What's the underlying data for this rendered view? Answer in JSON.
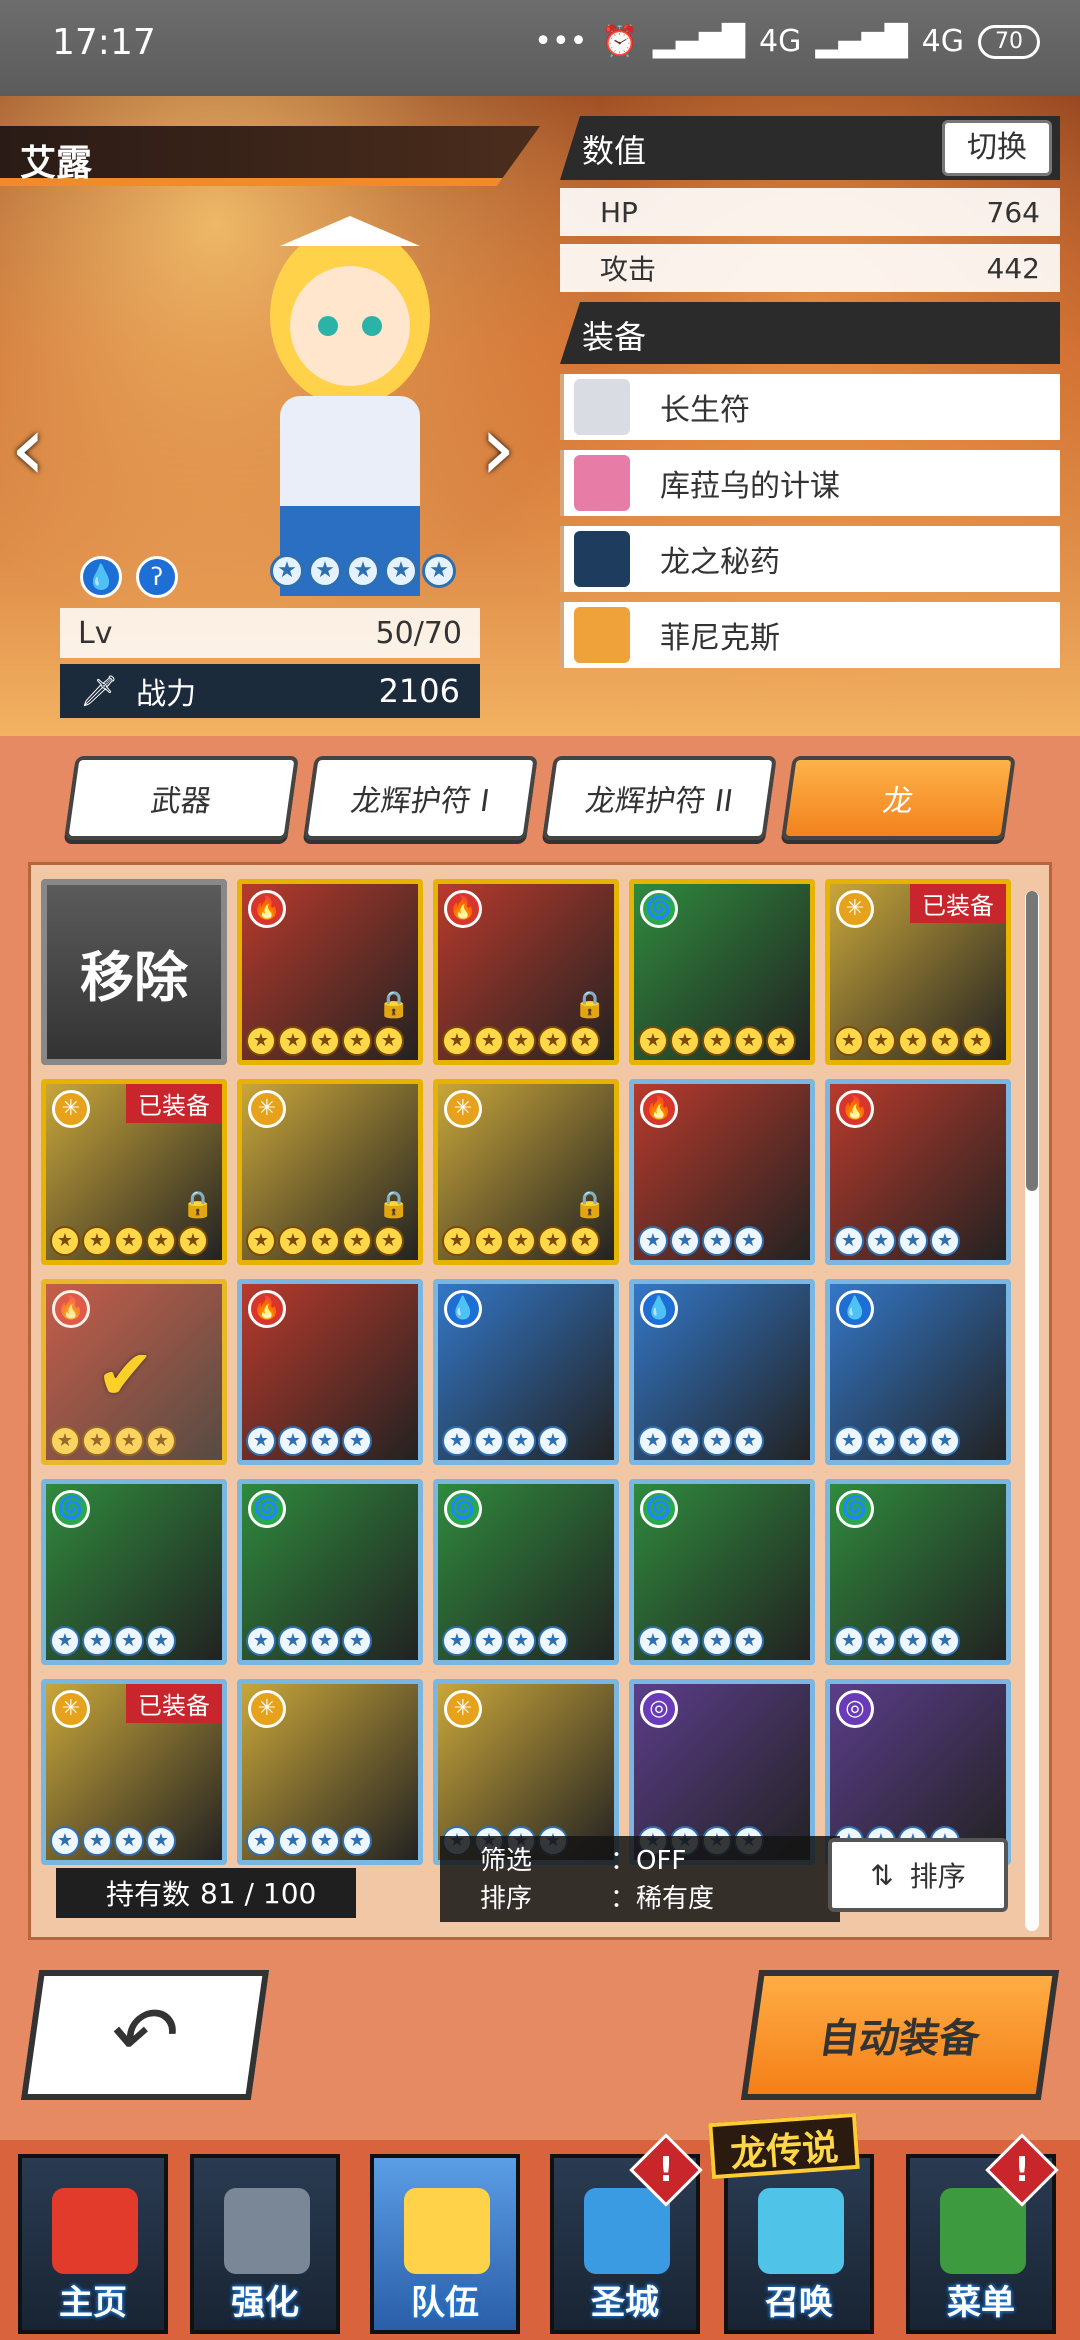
{
  "status": {
    "time": "17:17",
    "dots": "•••",
    "net1": "4G",
    "net2": "4G",
    "battery": "70"
  },
  "hero": {
    "name": "艾露",
    "level_label": "Lv",
    "level_value": "50/70",
    "power_label": "战力",
    "power_value": "2106",
    "stars": 5
  },
  "stats": {
    "header": "数值",
    "switch_label": "切换",
    "rows": [
      {
        "label": "HP",
        "value": "764"
      },
      {
        "label": "攻击",
        "value": "442"
      }
    ]
  },
  "equipment": {
    "header": "装备",
    "items": [
      "长生符",
      "库菈乌的计谋",
      "龙之秘药",
      "菲尼克斯"
    ]
  },
  "tabs": [
    "武器",
    "龙辉护符 I",
    "龙辉护符 II",
    "龙"
  ],
  "grid": {
    "remove_label": "移除",
    "equipped_label": "已装备",
    "cells": [
      {
        "frame": "gold",
        "element": "fire",
        "stars": 5,
        "equipped": false,
        "locked": true
      },
      {
        "frame": "gold",
        "element": "fire",
        "stars": 5,
        "equipped": false,
        "locked": true
      },
      {
        "frame": "gold",
        "element": "wind",
        "stars": 5,
        "equipped": false,
        "locked": false
      },
      {
        "frame": "gold",
        "element": "light",
        "stars": 5,
        "equipped": true,
        "locked": false
      },
      {
        "frame": "gold",
        "element": "light",
        "stars": 5,
        "equipped": true,
        "locked": true
      },
      {
        "frame": "gold",
        "element": "light",
        "stars": 5,
        "equipped": false,
        "locked": true
      },
      {
        "frame": "gold",
        "element": "light",
        "stars": 5,
        "equipped": false,
        "locked": true
      },
      {
        "frame": "blue",
        "element": "fire",
        "stars": 4,
        "equipped": false,
        "locked": false
      },
      {
        "frame": "blue",
        "element": "fire",
        "stars": 4,
        "equipped": false,
        "locked": false
      },
      {
        "frame": "gold",
        "element": "fire",
        "stars": 4,
        "equipped": false,
        "locked": false,
        "selected": true
      },
      {
        "frame": "blue",
        "element": "fire",
        "stars": 4,
        "equipped": false,
        "locked": false
      },
      {
        "frame": "blue",
        "element": "water",
        "stars": 4,
        "equipped": false,
        "locked": false
      },
      {
        "frame": "blue",
        "element": "water",
        "stars": 4,
        "equipped": false,
        "locked": false
      },
      {
        "frame": "blue",
        "element": "water",
        "stars": 4,
        "equipped": false,
        "locked": false
      },
      {
        "frame": "blue",
        "element": "wind",
        "stars": 4,
        "equipped": false,
        "locked": false
      },
      {
        "frame": "blue",
        "element": "wind",
        "stars": 4,
        "equipped": false,
        "locked": false
      },
      {
        "frame": "blue",
        "element": "wind",
        "stars": 4,
        "equipped": false,
        "locked": false
      },
      {
        "frame": "blue",
        "element": "wind",
        "stars": 4,
        "equipped": false,
        "locked": false
      },
      {
        "frame": "blue",
        "element": "wind",
        "stars": 4,
        "equipped": false,
        "locked": false
      },
      {
        "frame": "blue",
        "element": "light",
        "stars": 4,
        "equipped": true,
        "locked": false
      },
      {
        "frame": "blue",
        "element": "light",
        "stars": 4,
        "equipped": false,
        "locked": false
      },
      {
        "frame": "blue",
        "element": "light",
        "stars": 4,
        "equipped": false,
        "locked": false
      },
      {
        "frame": "blue",
        "element": "shadow",
        "stars": 4,
        "equipped": false,
        "locked": false
      },
      {
        "frame": "blue",
        "element": "shadow",
        "stars": 4,
        "equipped": false,
        "locked": false
      }
    ]
  },
  "footer": {
    "owned_label": "持有数",
    "owned_value": "81 / 100",
    "filter_label": "筛选",
    "filter_value": "：OFF",
    "sort_label": "排序",
    "sort_value": "：稀有度",
    "sort_button": "排序",
    "auto_equip": "自动装备"
  },
  "nav": {
    "logo": "龙传说",
    "items": [
      "主页",
      "强化",
      "队伍",
      "圣城",
      "召唤",
      "菜单"
    ]
  },
  "colors": {
    "accent": "#f2821c",
    "equipped_red": "#c8262c",
    "panel": "#f2c7a6"
  }
}
